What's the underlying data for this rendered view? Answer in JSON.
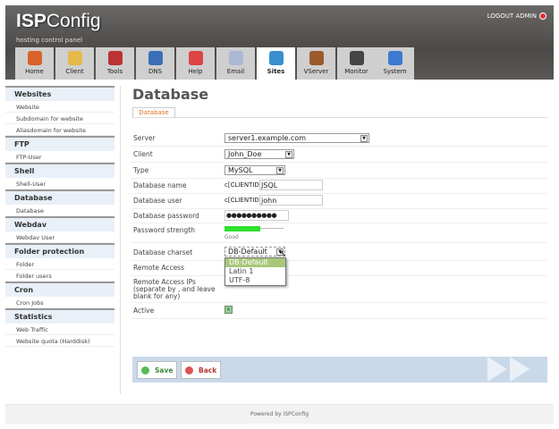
{
  "header": {
    "logo_main": "ISP",
    "logo_rest": "Config",
    "tagline": "hosting control panel",
    "logout": "LOGOUT ADMIN"
  },
  "tabs": [
    {
      "label": "Home",
      "color": "#d9612a"
    },
    {
      "label": "Client",
      "color": "#e5b94a"
    },
    {
      "label": "Tools",
      "color": "#b33"
    },
    {
      "label": "DNS",
      "color": "#3a6fb8"
    },
    {
      "label": "Help",
      "color": "#d44"
    },
    {
      "label": "Email",
      "color": "#aab8d6"
    },
    {
      "label": "Sites",
      "color": "#3a8fd0"
    },
    {
      "label": "VServer",
      "color": "#9a5a2a"
    },
    {
      "label": "Monitor",
      "color": "#444"
    },
    {
      "label": "System",
      "color": "#3a7ad0"
    }
  ],
  "sidebar": [
    {
      "title": "Websites",
      "items": [
        "Website",
        "Subdomain for website",
        "Aliasdomain for website"
      ]
    },
    {
      "title": "FTP",
      "items": [
        "FTP-User"
      ]
    },
    {
      "title": "Shell",
      "items": [
        "Shell-User"
      ]
    },
    {
      "title": "Database",
      "items": [
        "Database"
      ]
    },
    {
      "title": "Webdav",
      "items": [
        "Webdav User"
      ]
    },
    {
      "title": "Folder protection",
      "items": [
        "Folder",
        "Folder users"
      ]
    },
    {
      "title": "Cron",
      "items": [
        "Cron Jobs"
      ]
    },
    {
      "title": "Statistics",
      "items": [
        "Web Traffic",
        "Website quota (Harddisk)"
      ]
    }
  ],
  "main": {
    "title": "Database",
    "form_tab": "Database"
  },
  "form": {
    "server_label": "Server",
    "server_value": "server1.example.com",
    "client_label": "Client",
    "client_value": "John_Doe",
    "type_label": "Type",
    "type_value": "MySQL",
    "dbname_label": "Database name",
    "dbname_prefix": "c[CLIENTID]",
    "dbname_value": "JSQL",
    "dbuser_label": "Database user",
    "dbuser_prefix": "c[CLIENTID]",
    "dbuser_value": "john",
    "password_label": "Database password",
    "password_value": "●●●●●●●●●●",
    "strength_label": "Password strength",
    "strength_text": "Good",
    "strength_fraction": 0.6,
    "charset_label": "Database charset",
    "charset_value": "DB-Default",
    "charset_options": [
      "DB-Default",
      "Latin 1",
      "UTF-8"
    ],
    "remote_label": "Remote Access",
    "remote_ips_label": "Remote Access IPs (separate by , and leave blank for any)",
    "active_label": "Active",
    "active_checked": true
  },
  "buttons": {
    "save": "Save",
    "back": "Back"
  },
  "footer": "Powered by ISPConfig"
}
